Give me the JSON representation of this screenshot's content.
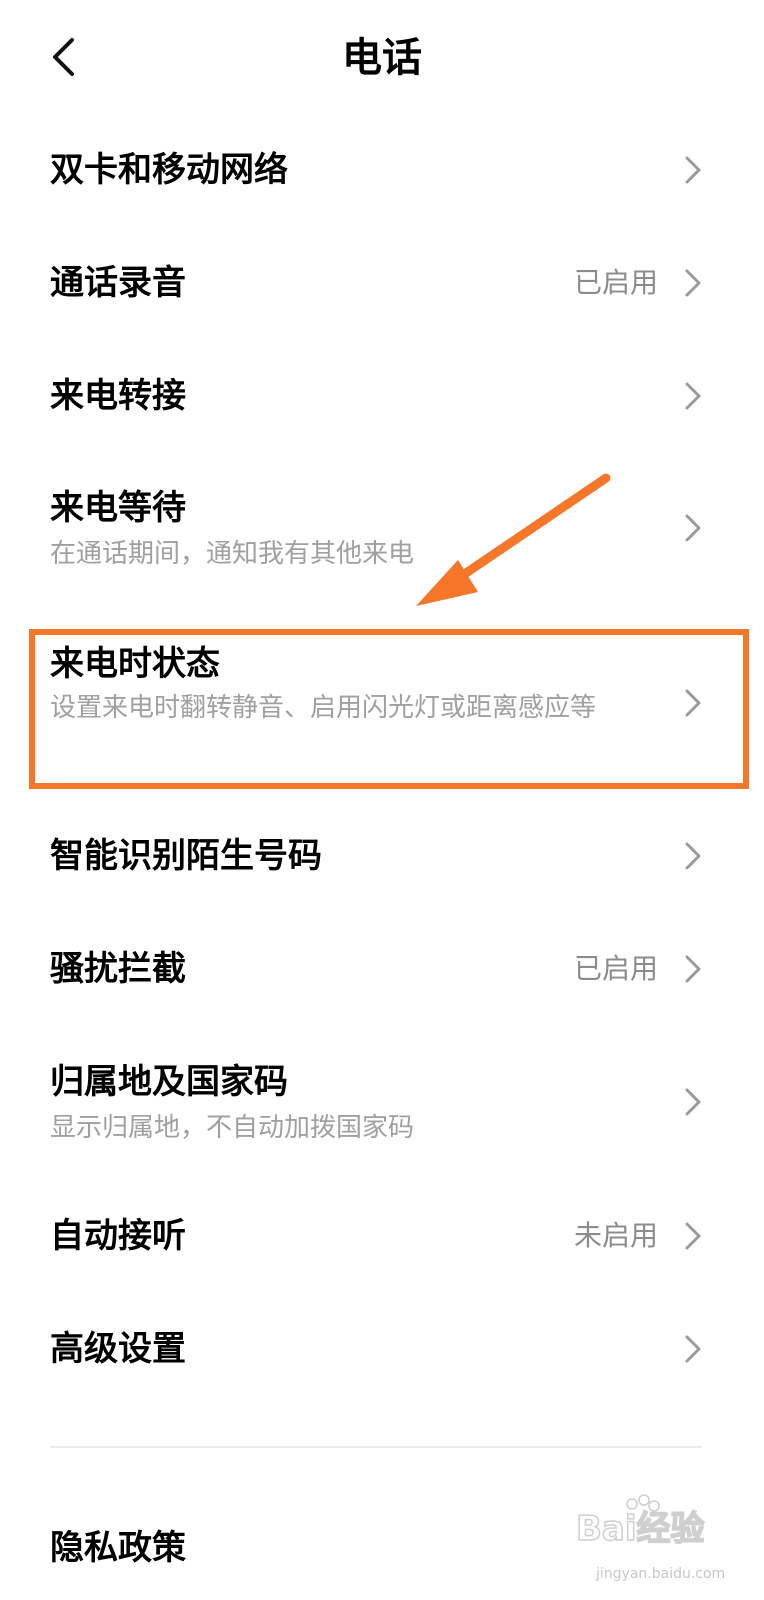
{
  "header": {
    "title": "电话",
    "back_icon": "chevron-left-icon"
  },
  "items": [
    {
      "id": "dual-sim",
      "title": "双卡和移动网络",
      "subtitle": "",
      "value": ""
    },
    {
      "id": "call-recording",
      "title": "通话录音",
      "subtitle": "",
      "value": "已启用"
    },
    {
      "id": "call-forwarding",
      "title": "来电转接",
      "subtitle": "",
      "value": ""
    },
    {
      "id": "call-waiting",
      "title": "来电等待",
      "subtitle": "在通话期间，通知我有其他来电",
      "value": ""
    },
    {
      "id": "incoming-call-state",
      "title": "来电时状态",
      "subtitle": "设置来电时翻转静音、启用闪光灯或距离感应等",
      "value": ""
    },
    {
      "id": "caller-id",
      "title": "智能识别陌生号码",
      "subtitle": "",
      "value": ""
    },
    {
      "id": "spam-blocking",
      "title": "骚扰拦截",
      "subtitle": "",
      "value": "已启用"
    },
    {
      "id": "location-country-code",
      "title": "归属地及国家码",
      "subtitle": "显示归属地，不自动加拨国家码",
      "value": ""
    },
    {
      "id": "auto-answer",
      "title": "自动接听",
      "subtitle": "",
      "value": "未启用"
    },
    {
      "id": "advanced-settings",
      "title": "高级设置",
      "subtitle": "",
      "value": ""
    },
    {
      "id": "privacy-policy",
      "title": "隐私政策",
      "subtitle": "",
      "value": ""
    }
  ],
  "annotation": {
    "highlighted_item": "来电时状态",
    "color": "#f6772a"
  },
  "watermark": {
    "brand": "Bai经验",
    "url": "jingyan.baidu.com"
  },
  "colors": {
    "title": "#000000",
    "subtitle": "#a0a0a0",
    "value": "#8c8c8c",
    "chevron": "#9a9a9a",
    "highlight": "#f6772a"
  }
}
